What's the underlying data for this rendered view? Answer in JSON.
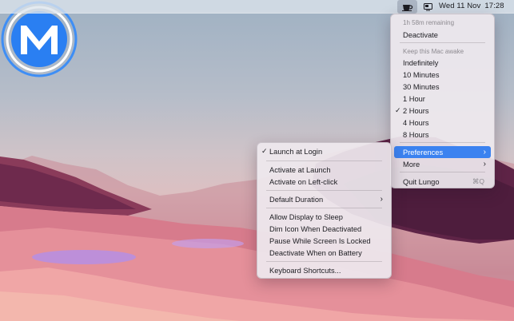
{
  "menubar": {
    "icons": [
      "coffee-cup-icon",
      "display-icon"
    ],
    "date": "Wed 11 Nov",
    "time": "17:28"
  },
  "main_menu": {
    "remaining": "1h 58m remaining",
    "deactivate": "Deactivate",
    "keep_awake_header": "Keep this Mac awake",
    "durations": [
      "Indefinitely",
      "10 Minutes",
      "30 Minutes",
      "1 Hour",
      "2 Hours",
      "4 Hours",
      "8 Hours"
    ],
    "checked_duration": "2 Hours",
    "preferences": "Preferences",
    "more": "More",
    "quit": "Quit Lungo",
    "quit_shortcut": "⌘Q"
  },
  "preferences_menu": {
    "launch_at_login": "Launch at Login",
    "activate_at_launch": "Activate at Launch",
    "activate_left_click": "Activate on Left-click",
    "default_duration": "Default Duration",
    "allow_display_sleep": "Allow Display to Sleep",
    "dim_icon": "Dim Icon When Deactivated",
    "pause_locked": "Pause While Screen Is Locked",
    "deactivate_battery": "Deactivate When on Battery",
    "keyboard_shortcuts": "Keyboard Shortcuts..."
  },
  "colors": {
    "accent": "#3b82f0",
    "logo_blue": "#1f7cf0"
  }
}
